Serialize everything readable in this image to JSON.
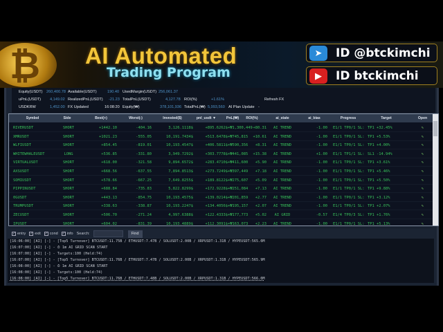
{
  "banner": {
    "title": "AI Automated",
    "subtitle": "Trading Program",
    "telegram": "ID @btckimchi",
    "youtube": "ID btckimchi"
  },
  "summary": {
    "equity_label": "Equity(USDT)",
    "equity": "260,400.78",
    "available_label": "Available(USDT)",
    "available": "190.40",
    "used_margin_label": "UsedMargin(USDT)",
    "used_margin": "256,061.37",
    "upnl_label": "uPnL(USDT)",
    "upnl": "4,149.02",
    "realized_label": "RealizedPnL(USDT)",
    "realized": "-21.23",
    "totalpnl_label": "TotalPnL(USDT)",
    "totalpnl": "4,127.78",
    "roi_label": "ROI(%)",
    "roi": "+1.61%",
    "refresh_fx": "Refresh FX",
    "usdkrw_label": "USDKRW",
    "usdkrw": "1,452.00",
    "fx_updated_label": "FX Updated",
    "fx_updated": "16:08:20",
    "equity_krw_label": "Equity(₩)",
    "equity_krw": "378,101,936",
    "totalpnl_krw_label": "TotalPnL(₩)",
    "totalpnl_krw": "5,993,560",
    "ai_plan_label": "AI Plan Update",
    "ai_plan": "-"
  },
  "table": {
    "headers": [
      "Symbol",
      "Side",
      "Best(+)",
      "Worst(-)",
      "Invested($)",
      "pnl_usdt ▼",
      "PnL(₩)",
      "ROI(%)",
      "ai_state",
      "ai_bias",
      "Progress",
      "Target",
      "Open"
    ],
    "rows": [
      [
        "RIVERUSDT",
        "SHORT",
        "+1442.10",
        "-404.16",
        "3,126.1118$",
        "+895.6262$",
        "+₩1,300,449",
        "+80.31",
        "AI TREND",
        "-1.00",
        "E1/1 TP0/1 SL:",
        "TP1 +32.45%"
      ],
      [
        "XMRUSDT",
        "SHORT",
        "+1021.23",
        "-555.05",
        "10,191.7434$",
        "+513.6478$",
        "+₩745,815",
        "+10.61",
        "AI TREND",
        "-1.00",
        "E1/1 TP0/1 SL:",
        "TP1 +5.53%"
      ],
      [
        "WLFIUSDT",
        "SHORT",
        "+854.45",
        "-819.01",
        "10,193.4547$",
        "+406.5811$",
        "+₩590,356",
        "+8.31",
        "AI TREND",
        "-1.00",
        "E1/1 TP0/1 SL:",
        "TP1 +4.00%"
      ],
      [
        "WHITEWHALEUSDT",
        "LONG",
        "+536.85",
        "-331.80",
        "3,949.7292$",
        "+303.7778$",
        "+₩441,085",
        "+15.38",
        "AI TREND",
        "+1.00",
        "E1/1 TP1/1 SL:",
        "SL1 -14.94%"
      ],
      [
        "VIRTUALUSDT",
        "SHORT",
        "+618.00",
        "-321.58",
        "9,894.6572$",
        "+283.4710$",
        "+₩411,600",
        "+5.90",
        "AI TREND",
        "-1.00",
        "E1/1 TP0/1 SL:",
        "TP1 +3.61%"
      ],
      [
        "AXSUSDT",
        "SHORT",
        "+668.56",
        "-637.55",
        "7,894.8513$",
        "+273.7249$",
        "+₩397,449",
        "+7.18",
        "AI TREND",
        "-1.00",
        "E1/1 TP0/1 SL:",
        "TP1 +5.46%"
      ],
      [
        "SOMIUSDT",
        "SHORT",
        "+578.66",
        "-667.25",
        "7,649.8255$",
        "+189.8122$",
        "+₩275,607",
        "+5.09",
        "AI TREND",
        "-1.00",
        "E1/1 TP0/1 SL:",
        "TP1 +5.50%"
      ],
      [
        "PIPPINUSDT",
        "SHORT",
        "+688.84",
        "-735.83",
        "5,822.8299$",
        "+172.9228$",
        "+₩251,084",
        "+7.13",
        "AI TREND",
        "-1.00",
        "E1/1 TP0/1 SL:",
        "TP1 +9.88%"
      ],
      [
        "0GUSDT",
        "SHORT",
        "+443.13",
        "-854.75",
        "10,193.4575$",
        "+139.0214$",
        "+₩201,859",
        "+2.77",
        "AI TREND",
        "-1.00",
        "E1/1 TP0/1 SL:",
        "TP1 +3.12%"
      ],
      [
        "TRUMPUSDT",
        "SHORT",
        "+338.63",
        "-338.87",
        "10,193.2247$",
        "+134.4056$",
        "+₩195,157",
        "+2.07",
        "AI TREND",
        "-1.00",
        "E1/1 TP0/1 SL:",
        "TP1 +2.07%"
      ],
      [
        "ZECUSDT",
        "SHORT",
        "+506.70",
        "-271.24",
        "4,997.6388$",
        "+122.4333$",
        "+₩177,773",
        "+5.02",
        "AI GRID",
        "-0.57",
        "E1/4 TP0/3 SL:",
        "TP1 +1.76%"
      ],
      [
        "IPUSDT",
        "SHORT",
        "+604.02",
        "-831.39",
        "10,193.4889$",
        "+112.3091$",
        "+₩163,073",
        "+2.23",
        "AI TREND",
        "-1.00",
        "E1/1 TP0/1 SL:",
        "TP1 +5.13%"
      ]
    ]
  },
  "filters": {
    "entry": "entry",
    "exit": "exit",
    "cond": "cond",
    "info": "info",
    "search_label": "Search:",
    "search_value": "",
    "find": "Find"
  },
  "log": [
    "[16:06:00] [AI] [-] - [Top5 Turnover] BTCUSDT:11.75B / ETHUSDT:7.47B / SOLUSDT:2.00B / XRPUSDT:1.31B / HYPEUSDT:565.0M",
    "[16:07:00] [AI] [-] - ⏱ 1m AI GRID SCAN START",
    "[16:07:00] [AI] [-] - Targets:100 (Held:74)",
    "[16:07:00] [AI] [-] - [Top5 Turnover] BTCUSDT:11.76B / ETHUSDT:7.47B / SOLUSDT:2.00B / XRPUSDT:1.31B / HYPEUSDT:565.9M",
    "[16:08:00] [AI] [-] - ⏱ 1m AI GRID SCAN START",
    "[16:08:00] [AI] [-] - Targets:100 (Held:74)",
    "[16:08:00] [AI] [-] - [Top5 Turnover] BTCUSDT:11.76B / ETHUSDT:7.48B / SOLUSDT:2.00B / XRPUSDT:1.31B / HYPEUSDT:566.0M"
  ]
}
